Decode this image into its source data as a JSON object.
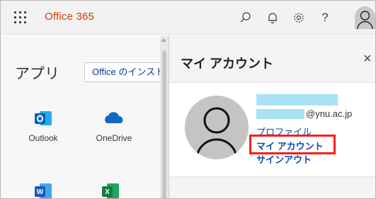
{
  "topbar": {
    "app_name": "Office 365",
    "waffle_icon": "app-launcher-icon",
    "icons": [
      "search-icon",
      "bell-icon",
      "gear-icon",
      "help-icon"
    ],
    "help_label": "?",
    "avatar_icon": "user-avatar-icon"
  },
  "apps": {
    "title": "アプリ",
    "install_label": "Office のインストール",
    "items": [
      {
        "label": "Outlook",
        "icon": "outlook-icon",
        "color": "#0364b8"
      },
      {
        "label": "OneDrive",
        "icon": "onedrive-icon",
        "color": "#0f6cbd"
      },
      {
        "label": "",
        "icon": "word-icon",
        "color": "#185abd"
      },
      {
        "label": "",
        "icon": "excel-icon",
        "color": "#107c41"
      }
    ]
  },
  "flyout": {
    "title": "マイ アカウント",
    "close_label": "×",
    "email_suffix": "@ynu.ac.jp",
    "links": {
      "profile": "プロファイル",
      "my_account": "マイ アカウント",
      "sign_out": "サインアウト"
    }
  },
  "colors": {
    "brand_orange": "#d83b01",
    "link_blue": "#0b4aa8",
    "highlight_red": "#ff1a1a",
    "redaction": "#a9e3f3"
  }
}
